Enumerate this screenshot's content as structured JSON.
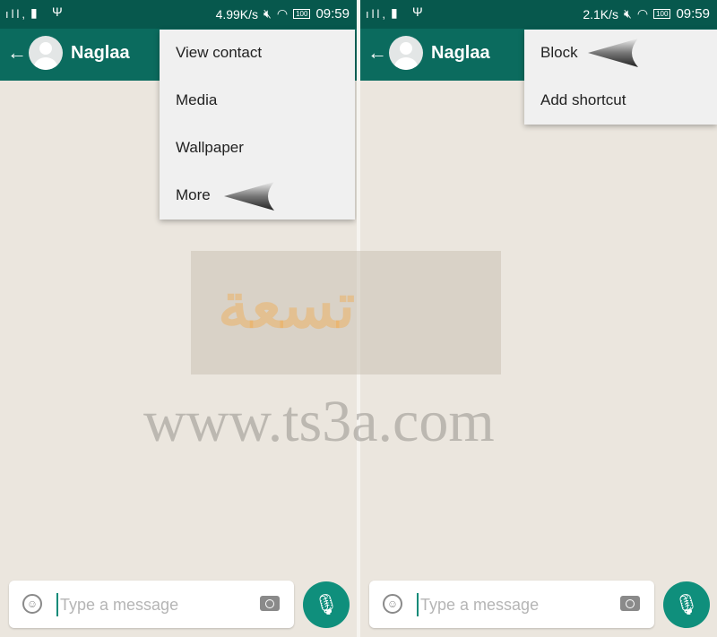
{
  "panels": [
    {
      "status": {
        "signal": "ıll,",
        "speed": "4.99K/s",
        "battery": "100",
        "time": "09:59"
      },
      "header": {
        "contact_name": "Naglaa"
      },
      "menu": [
        "View contact",
        "Media",
        "Wallpaper",
        "More"
      ],
      "input": {
        "placeholder": "Type a message"
      }
    },
    {
      "status": {
        "signal": "ıll,",
        "speed": "2.1K/s",
        "battery": "100",
        "time": "09:59"
      },
      "header": {
        "contact_name": "Naglaa"
      },
      "menu": [
        "Block",
        "Add shortcut"
      ],
      "input": {
        "placeholder": "Type a message"
      }
    }
  ],
  "watermark": {
    "logo": "تسعة",
    "url": "www.ts3a.com"
  },
  "colors": {
    "status_bar": "#07584d",
    "header": "#0b6b5e",
    "mic": "#0f8f7c",
    "chat_bg": "#ebe6de"
  }
}
